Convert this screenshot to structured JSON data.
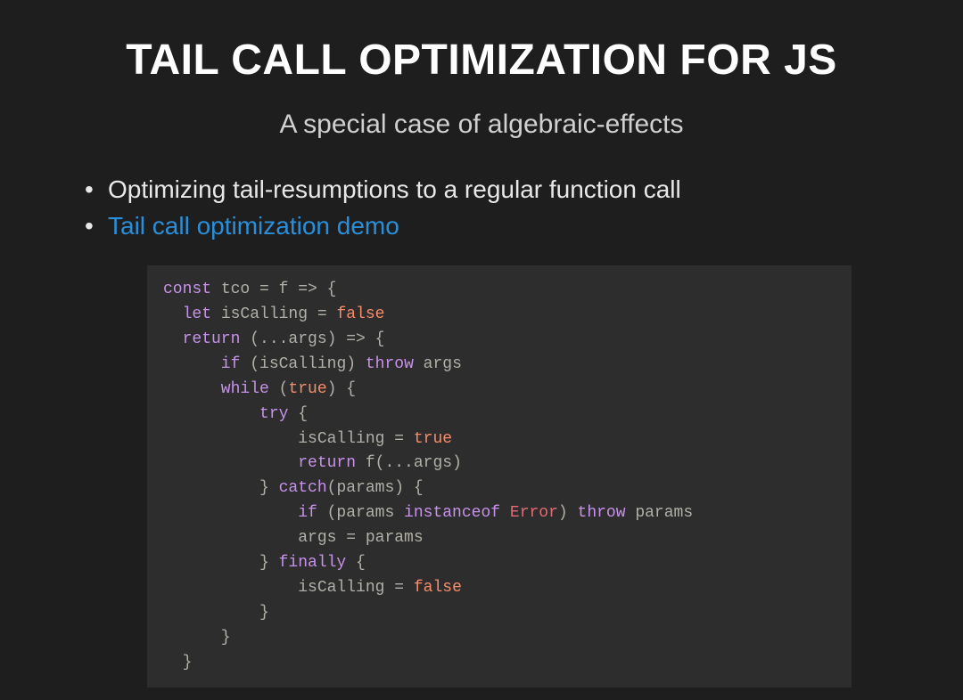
{
  "title": "TAIL CALL OPTIMIZATION FOR JS",
  "subtitle": "A special case of algebraic-effects",
  "bullets": {
    "item1": "Optimizing tail-resumptions to a regular function call",
    "item2": "Tail call optimization demo"
  },
  "code": {
    "line1_a": "const",
    "line1_b": " tco = f => {",
    "line2_a": "  let",
    "line2_b": " isCalling = ",
    "line2_c": "false",
    "line3_a": "  return",
    "line3_b": " (...args) => {",
    "line4_a": "      if",
    "line4_b": " (isCalling) ",
    "line4_c": "throw",
    "line4_d": " args",
    "line5_a": "      while",
    "line5_b": " (",
    "line5_c": "true",
    "line5_d": ") {",
    "line6_a": "          try",
    "line6_b": " {",
    "line7_a": "              isCalling = ",
    "line7_b": "true",
    "line8_a": "              return",
    "line8_b": " f(...args)",
    "line9_a": "          } ",
    "line9_b": "catch",
    "line9_c": "(params) {",
    "line10_a": "              if",
    "line10_b": " (params ",
    "line10_c": "instanceof",
    "line10_d": " ",
    "line10_e": "Error",
    "line10_f": ") ",
    "line10_g": "throw",
    "line10_h": " params",
    "line11": "              args = params",
    "line12_a": "          } ",
    "line12_b": "finally",
    "line12_c": " {",
    "line13_a": "              isCalling = ",
    "line13_b": "false",
    "line14": "          }",
    "line15": "      }",
    "line16": "  }"
  }
}
